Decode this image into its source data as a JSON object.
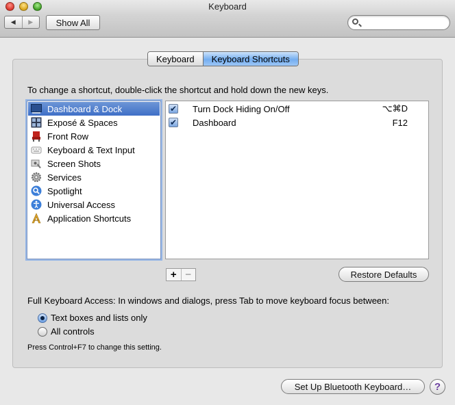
{
  "window": {
    "title": "Keyboard"
  },
  "toolbar": {
    "back_icon": "◀",
    "forward_icon": "▶",
    "show_all": "Show All",
    "search_value": ""
  },
  "tabs": [
    {
      "label": "Keyboard",
      "selected": false
    },
    {
      "label": "Keyboard Shortcuts",
      "selected": true
    }
  ],
  "instruction": "To change a shortcut, double-click the shortcut and hold down the new keys.",
  "categories": [
    {
      "label": "Dashboard & Dock",
      "icon": "dashboard-dock-icon",
      "selected": true
    },
    {
      "label": "Exposé & Spaces",
      "icon": "expose-spaces-icon"
    },
    {
      "label": "Front Row",
      "icon": "front-row-icon"
    },
    {
      "label": "Keyboard & Text Input",
      "icon": "keyboard-text-input-icon"
    },
    {
      "label": "Screen Shots",
      "icon": "screen-shots-icon"
    },
    {
      "label": "Services",
      "icon": "services-gear-icon"
    },
    {
      "label": "Spotlight",
      "icon": "spotlight-icon"
    },
    {
      "label": "Universal Access",
      "icon": "universal-access-icon"
    },
    {
      "label": "Application Shortcuts",
      "icon": "application-shortcuts-icon"
    }
  ],
  "shortcuts": [
    {
      "enabled": true,
      "action": "Turn Dock Hiding On/Off",
      "keys": "⌥⌘D"
    },
    {
      "enabled": true,
      "action": "Dashboard",
      "keys": "F12"
    }
  ],
  "list_controls": {
    "add": "+",
    "remove": "−"
  },
  "restore_defaults": "Restore Defaults",
  "full_keyboard_access": {
    "label": "Full Keyboard Access: In windows and dialogs, press Tab to move keyboard focus between:",
    "options": [
      {
        "label": "Text boxes and lists only",
        "selected": true
      },
      {
        "label": "All controls",
        "selected": false
      }
    ],
    "hint": "Press Control+F7 to change this setting."
  },
  "bluetooth_button": "Set Up Bluetooth Keyboard…",
  "help_button": "?"
}
